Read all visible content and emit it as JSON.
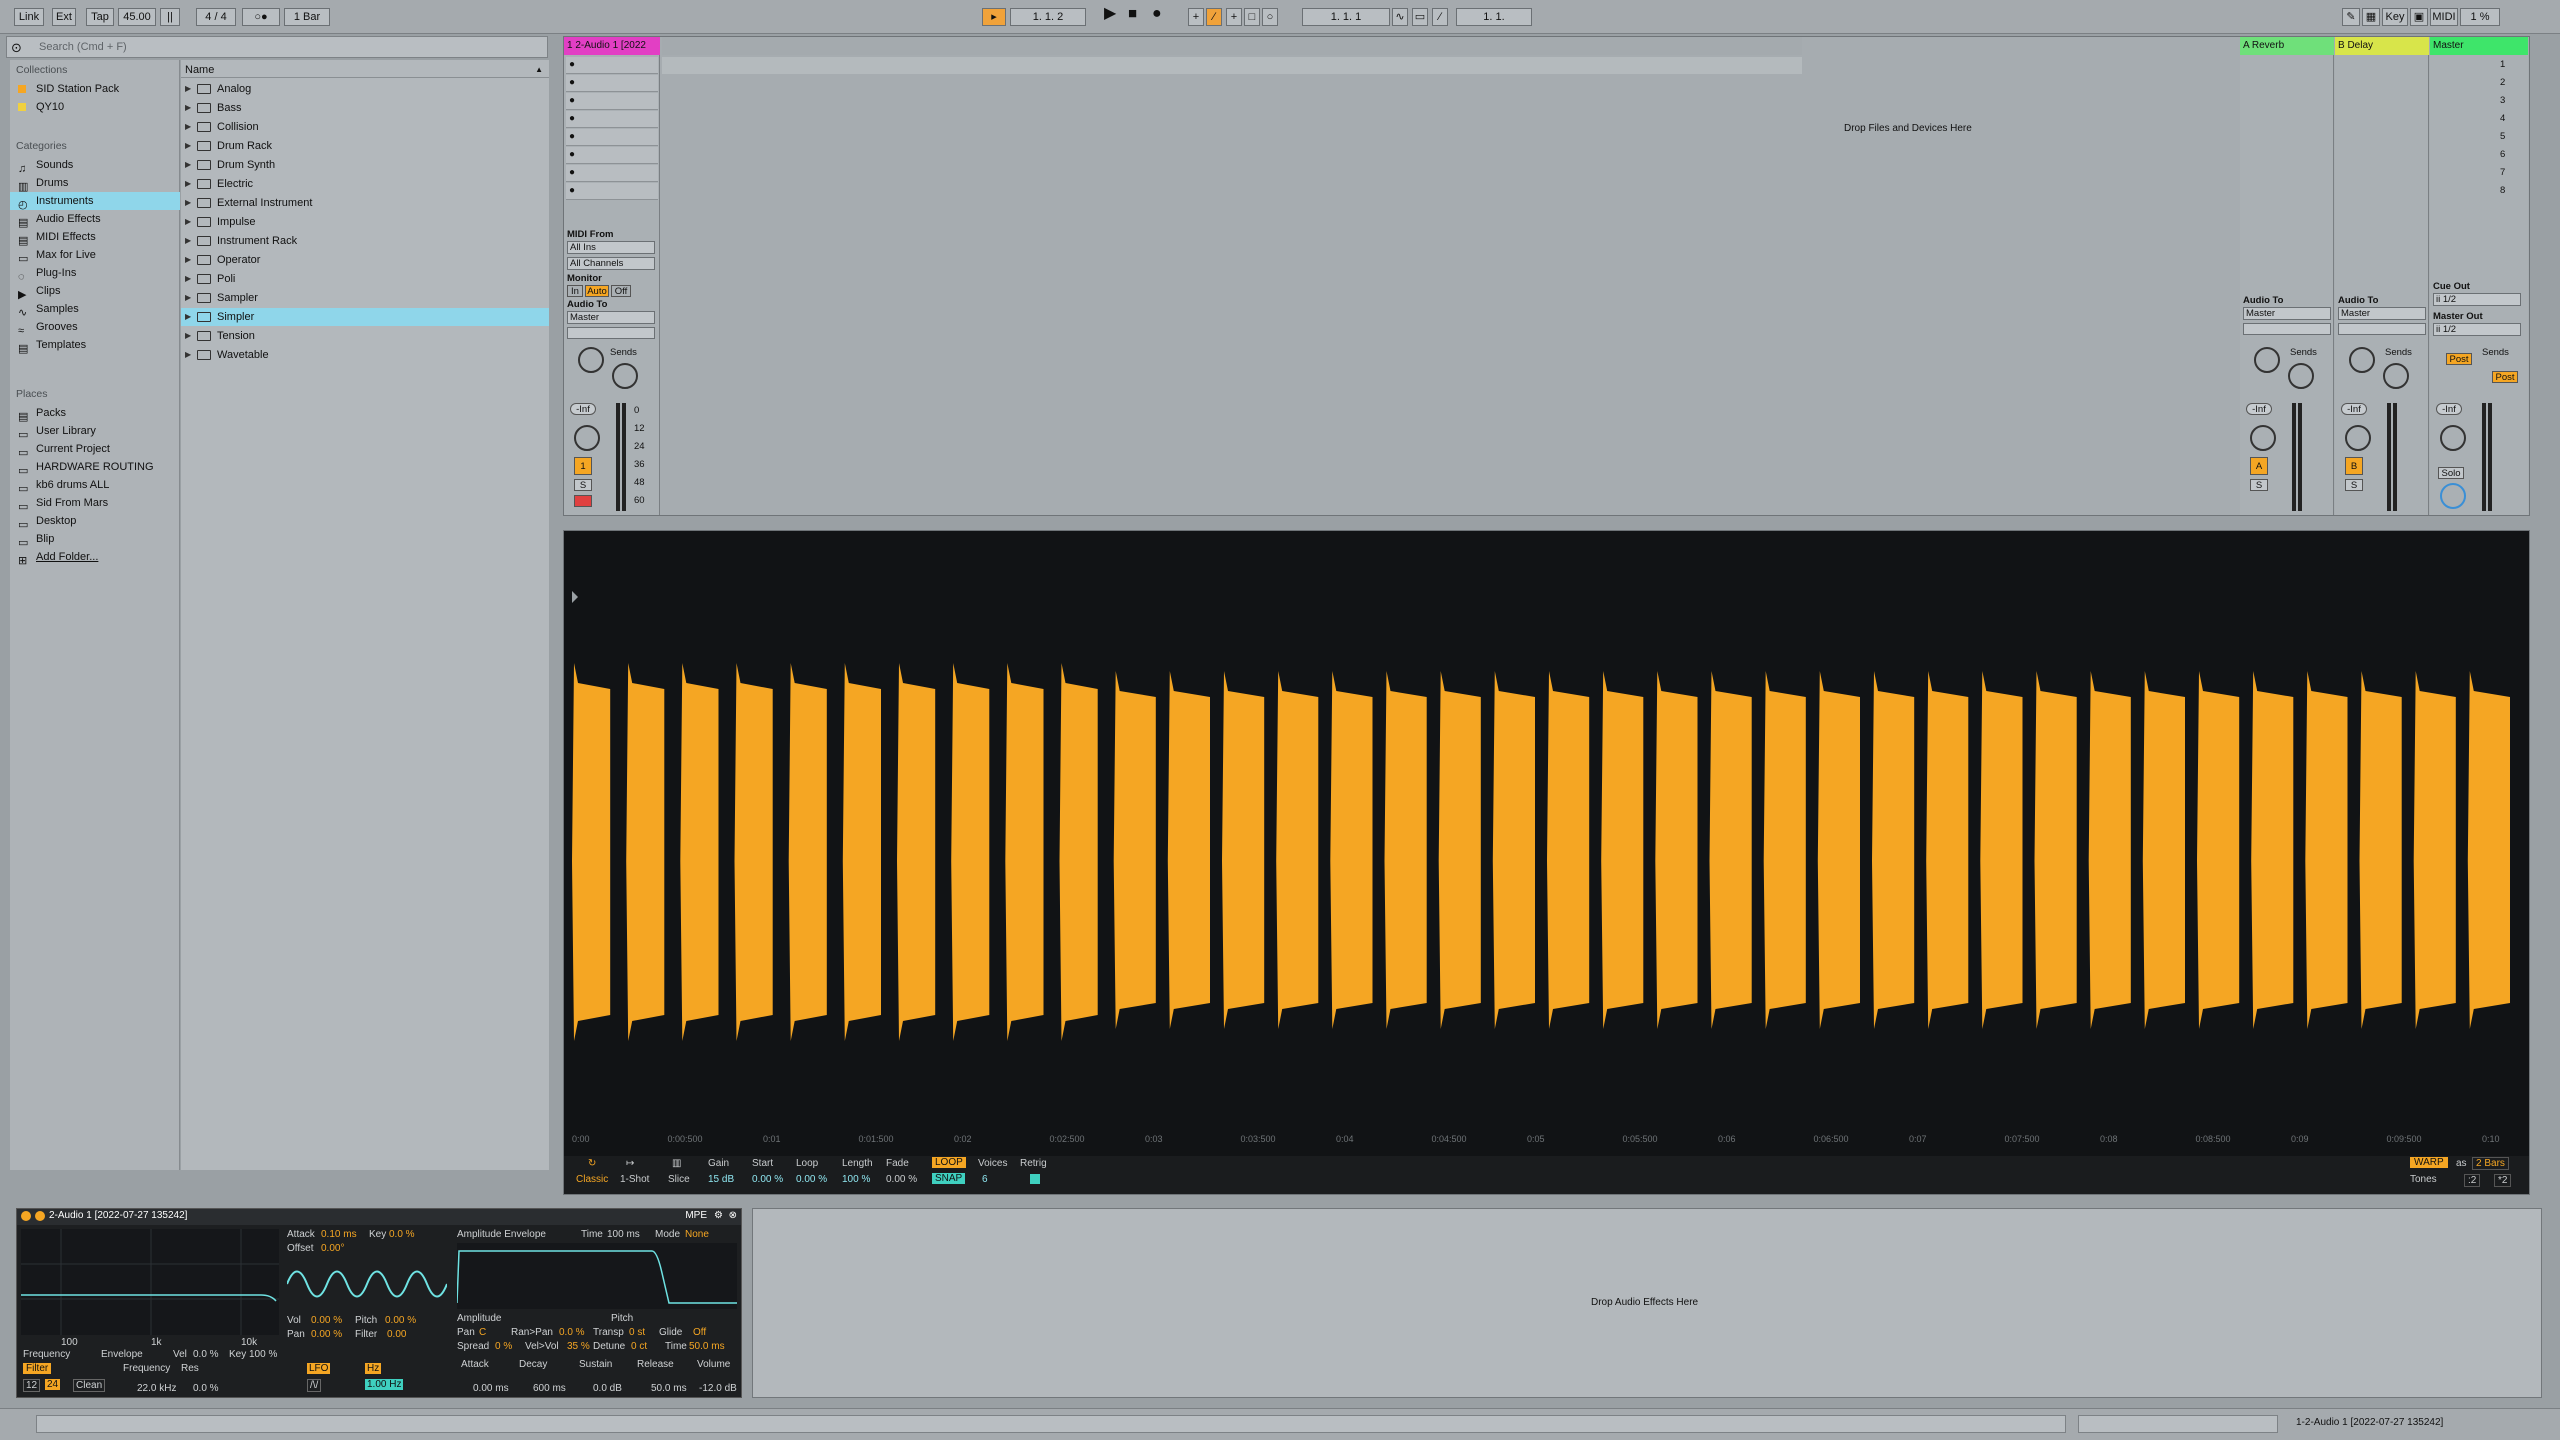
{
  "transport": {
    "link": "Link",
    "ext": "Ext",
    "tap": "Tap",
    "tempo": "45.00",
    "signature": "4 / 4",
    "quantize": "1 Bar",
    "position": "1.  1.  2",
    "loop_start": "1.  1.  1",
    "loop_length": "1.  1.",
    "key": "Key",
    "midi": "MIDI",
    "cpu": "1 %"
  },
  "browser": {
    "search_placeholder": "Search (Cmd + F)",
    "collections_title": "Collections",
    "collections": [
      "SID Station Pack",
      "QY10"
    ],
    "categories_title": "Categories",
    "categories": [
      "Sounds",
      "Drums",
      "Instruments",
      "Audio Effects",
      "MIDI Effects",
      "Max for Live",
      "Plug-Ins",
      "Clips",
      "Samples",
      "Grooves",
      "Templates"
    ],
    "selected_category": "Instruments",
    "places_title": "Places",
    "places": [
      "Packs",
      "User Library",
      "Current Project",
      "HARDWARE ROUTING",
      "kb6 drums ALL",
      "Sid From Mars",
      "Desktop",
      "Blip",
      "Add Folder..."
    ],
    "name_header": "Name",
    "items": [
      "Analog",
      "Bass",
      "Collision",
      "Drum Rack",
      "Drum Synth",
      "Electric",
      "External Instrument",
      "Impulse",
      "Instrument Rack",
      "Operator",
      "Poli",
      "Sampler",
      "Simpler",
      "Tension",
      "Wavetable"
    ],
    "selected_item": "Simpler"
  },
  "session": {
    "track_name": "1 2-Audio 1 [2022",
    "drop_hint": "Drop Files and Devices Here",
    "return_a": "A Reverb",
    "return_b": "B Delay",
    "master": "Master",
    "scene_numbers": [
      "1",
      "2",
      "3",
      "4",
      "5",
      "6",
      "7",
      "8"
    ],
    "midi_from": "MIDI From",
    "all_ins": "All Ins",
    "all_channels": "All Channels",
    "monitor": "Monitor",
    "monitor_in": "In",
    "monitor_auto": "Auto",
    "monitor_off": "Off",
    "audio_to": "Audio To",
    "master_dest": "Master",
    "sends": "Sends",
    "cue_out": "Cue Out",
    "cue_out_val": "ii 1/2",
    "master_out": "Master Out",
    "master_out_val": "ii 1/2",
    "post": "Post",
    "inf": "-Inf",
    "track_num": "1",
    "solo": "S",
    "ret_a_btn": "A",
    "ret_b_btn": "B",
    "solo_label": "Solo",
    "meter_scale": [
      "0",
      "12",
      "24",
      "36",
      "48",
      "60"
    ]
  },
  "clip": {
    "timeline": [
      "0:00",
      "0:00:500",
      "0:01",
      "0:01:500",
      "0:02",
      "0:02:500",
      "0:03",
      "0:03:500",
      "0:04",
      "0:04:500",
      "0:05",
      "0:05:500",
      "0:06",
      "0:06:500",
      "0:07",
      "0:07:500",
      "0:08",
      "0:08:500",
      "0:09",
      "0:09:500",
      "0:10"
    ],
    "classic": "Classic",
    "one_shot": "1-Shot",
    "slice": "Slice",
    "gain_label": "Gain",
    "gain": "15 dB",
    "start_label": "Start",
    "start": "0.00 %",
    "loop_label": "Loop",
    "loop": "0.00 %",
    "length_label": "Length",
    "length": "100 %",
    "fade_label": "Fade",
    "fade": "0.00 %",
    "loop_btn": "LOOP",
    "snap_btn": "SNAP",
    "voices_label": "Voices",
    "voices": "6",
    "retrig_label": "Retrig",
    "warp": "WARP",
    "as": "as",
    "bars": "2 Bars",
    "tones": "Tones",
    "half": ":2",
    "double": "*2"
  },
  "device": {
    "title": "2-Audio 1 [2022-07-27 135242]",
    "mpe": "MPE",
    "attack_label": "Attack",
    "attack": "0.10 ms",
    "key_label": "Key",
    "key": "0.0 %",
    "offset_label": "Offset",
    "offset": "0.00°",
    "vol_label": "Vol",
    "vol": "0.00 %",
    "pitch_label": "Pitch",
    "pitch": "0.00 %",
    "pan_label": "Pan",
    "pan": "0.00 %",
    "filter_label": "Filter",
    "filter": "0.00",
    "amp_env": "Amplitude Envelope",
    "time_label": "Time",
    "time": "100 ms",
    "mode_label": "Mode",
    "mode": "None",
    "amplitude": "Amplitude",
    "pitch_tab": "Pitch",
    "pan2_label": "Pan",
    "pan2": "C",
    "ranpan_label": "Ran>Pan",
    "ranpan": "0.0 %",
    "transp_label": "Transp",
    "transp": "0 st",
    "glide_label": "Glide",
    "glide": "Off",
    "spread_label": "Spread",
    "spread": "0 %",
    "velvol_label": "Vel>Vol",
    "velvol": "35 %",
    "detune_label": "Detune",
    "detune": "0 ct",
    "time2_label": "Time",
    "time2": "50.0 ms",
    "freq_axis": [
      "100",
      "1k",
      "10k"
    ],
    "frequency_tab": "Frequency",
    "envelope_tab": "Envelope",
    "vel_label": "Vel",
    "vel": "0.0 %",
    "key2_label": "Key",
    "key2": "100 %",
    "filter_btn": "Filter",
    "frequency_label": "Frequency",
    "frequency": "22.0 kHz",
    "res_label": "Res",
    "res": "0.0 %",
    "slope12": "12",
    "slope24": "24",
    "clean": "Clean",
    "lfo": "LFO",
    "hz": "Hz",
    "lfo_rate": "1.00 Hz",
    "attack2_label": "Attack",
    "attack2": "0.00 ms",
    "decay_label": "Decay",
    "decay": "600 ms",
    "sustain_label": "Sustain",
    "sustain": "0.0 dB",
    "release_label": "Release",
    "release": "50.0 ms",
    "volume_label": "Volume",
    "volume": "-12.0 dB"
  },
  "effects_drop_hint": "Drop Audio Effects Here",
  "status": {
    "track": "1-2-Audio 1 [2022-07-27 135242]"
  },
  "colors": {
    "accent_orange": "#f5a623",
    "selection_blue": "#8fd6ea",
    "track_pink": "#e23fc4",
    "return_green": "#6fe07a",
    "master_green": "#3ee56a"
  }
}
